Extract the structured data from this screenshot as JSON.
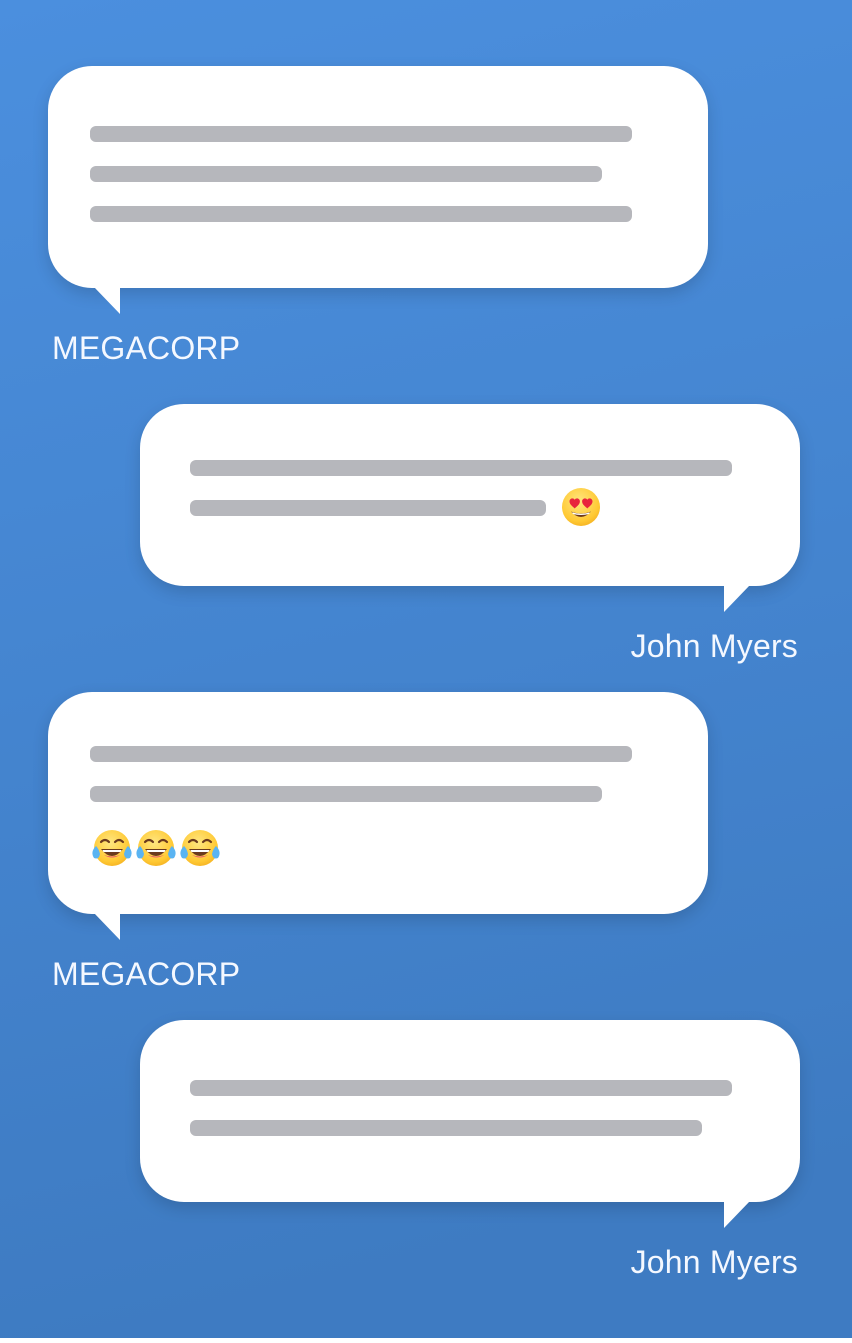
{
  "messages": [
    {
      "sender": "MEGACORP",
      "emojis": []
    },
    {
      "sender": "John Myers",
      "emojis": [
        "heart-eyes-emoji"
      ]
    },
    {
      "sender": "MEGACORP",
      "emojis": [
        "tears-of-joy-emoji",
        "tears-of-joy-emoji",
        "tears-of-joy-emoji"
      ]
    },
    {
      "sender": "John Myers",
      "emojis": []
    }
  ],
  "colors": {
    "background_top": "#4b8fde",
    "background_bottom": "#3f7cc3",
    "bubble": "#ffffff",
    "placeholder_line": "#b6b7bc",
    "sender_text": "#f4f8ff"
  }
}
